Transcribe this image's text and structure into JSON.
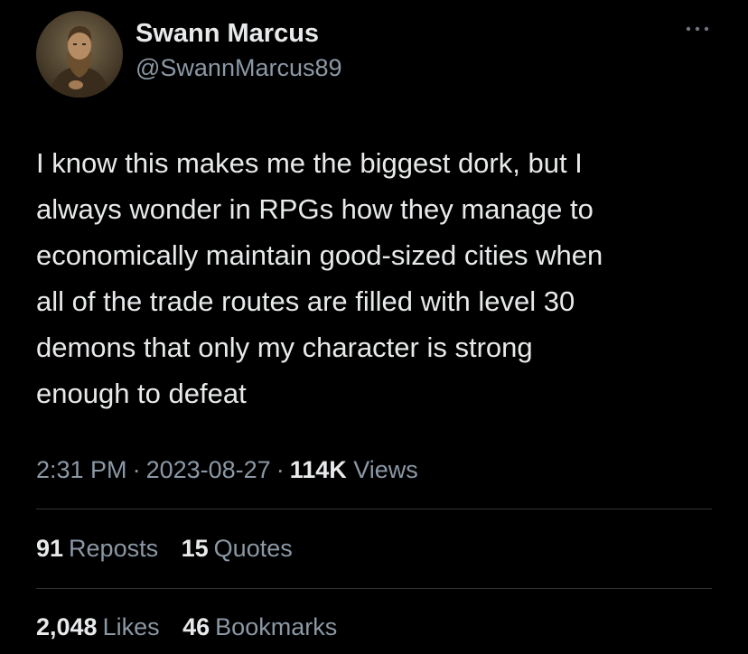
{
  "user": {
    "display_name": "Swann Marcus",
    "handle": "@SwannMarcus89",
    "avatar_icon": "portrait-avatar"
  },
  "more_icon": "more-horizontal-icon",
  "tweet": {
    "lines": [
      "I know this makes me the biggest dork, but I",
      "always wonder in RPGs how they manage to",
      "economically maintain good-sized cities when",
      "all of the trade routes are filled with level 30",
      "demons that only my character is strong",
      "enough to defeat"
    ]
  },
  "meta": {
    "time": "2:31 PM",
    "separator": "·",
    "date": "2023-08-27",
    "views_count": "114K",
    "views_label": "Views"
  },
  "stats": {
    "reposts": {
      "count": "91",
      "label": "Reposts"
    },
    "quotes": {
      "count": "15",
      "label": "Quotes"
    },
    "likes": {
      "count": "2,048",
      "label": "Likes"
    },
    "bookmarks": {
      "count": "46",
      "label": "Bookmarks"
    }
  },
  "colors": {
    "background": "#000000",
    "primary_text": "#e7e9ea",
    "secondary_text": "#8b98a5",
    "divider": "#2f3336"
  }
}
